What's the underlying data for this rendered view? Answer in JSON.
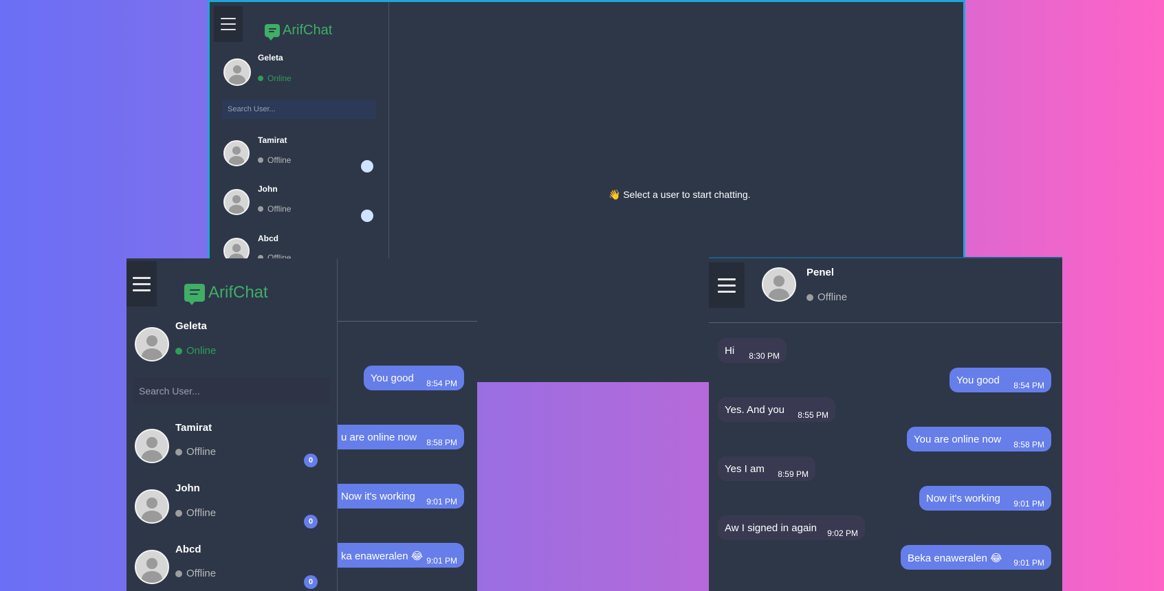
{
  "app": {
    "name": "ArifChat",
    "brand_color": "#3fae66",
    "accent_color": "#667eea"
  },
  "current_user": {
    "name": "Geleta",
    "status": "Online"
  },
  "search": {
    "placeholder": "Search User..."
  },
  "users": [
    {
      "name": "Tamirat",
      "status": "Offline",
      "unread": "0"
    },
    {
      "name": "John",
      "status": "Offline",
      "unread": "0"
    },
    {
      "name": "Abcd",
      "status": "Offline",
      "unread": "0"
    }
  ],
  "empty_state": {
    "icon": "waving-hand-icon",
    "text": "👋 Select a user to start chatting."
  },
  "chat": {
    "contact": {
      "name": "Penel",
      "status": "Offline"
    },
    "messages": [
      {
        "dir": "in",
        "text": "Hi",
        "time": "8:30 PM"
      },
      {
        "dir": "out",
        "text": "You good",
        "time": "8:54 PM"
      },
      {
        "dir": "in",
        "text": "Yes. And you",
        "time": "8:55 PM"
      },
      {
        "dir": "out",
        "text": "You are online now",
        "time": "8:58 PM"
      },
      {
        "dir": "in",
        "text": "Yes I am",
        "time": "8:59 PM"
      },
      {
        "dir": "out",
        "text": "Now it's working",
        "time": "9:01 PM"
      },
      {
        "dir": "in",
        "text": "Aw I signed in again",
        "time": "9:02 PM"
      },
      {
        "dir": "out",
        "text": "Beka enaweralen 😂",
        "time": "9:01 PM"
      }
    ],
    "partial_messages": [
      {
        "text": "You good",
        "time": "8:54 PM"
      },
      {
        "text": "u are online now",
        "time": "8:58 PM"
      },
      {
        "text": "Now it's working",
        "time": "9:01 PM"
      },
      {
        "text": "ka enaweralen 😂",
        "time": "9:01 PM"
      }
    ]
  }
}
